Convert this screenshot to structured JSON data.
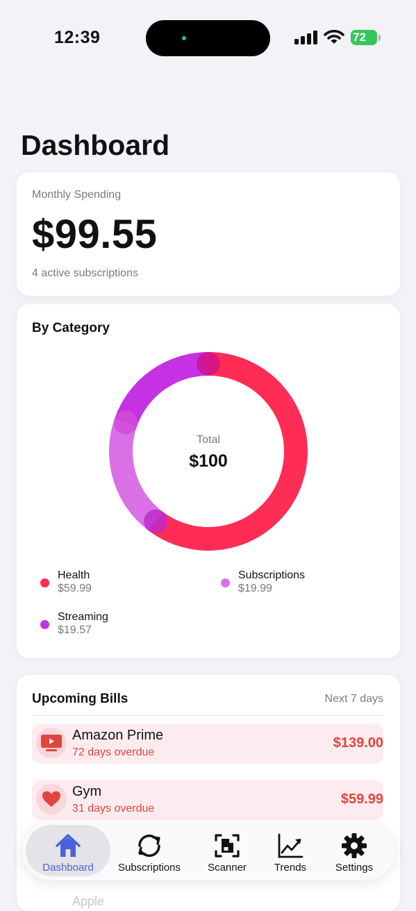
{
  "status_bar": {
    "time": "12:39",
    "battery": "72"
  },
  "page": {
    "title": "Dashboard"
  },
  "monthly": {
    "label": "Monthly Spending",
    "amount": "$99.55",
    "subtitle": "4 active subscriptions"
  },
  "category": {
    "title": "By Category",
    "center_label": "Total",
    "center_value": "$100"
  },
  "chart_data": {
    "type": "pie",
    "title": "By Category",
    "categories": [
      "Health",
      "Subscriptions",
      "Streaming"
    ],
    "values": [
      59.99,
      19.99,
      19.57
    ],
    "value_labels": [
      "$59.99",
      "$19.99",
      "$19.57"
    ],
    "colors": [
      "#ff2d55",
      "#da70e6",
      "#c532e3"
    ],
    "center_label": "Total",
    "center_value": "$100",
    "legend": "bottom"
  },
  "bills": {
    "title": "Upcoming Bills",
    "range": "Next 7 days",
    "items": [
      {
        "name": "Amazon Prime",
        "due": "72 days overdue",
        "amount": "$139.00",
        "icon": "tv-icon"
      },
      {
        "name": "Gym",
        "due": "31 days overdue",
        "amount": "$59.99",
        "icon": "heart-icon"
      }
    ],
    "peek_text": "Apple"
  },
  "tabs": [
    {
      "label": "Dashboard",
      "icon": "house-icon",
      "active": true
    },
    {
      "label": "Subscriptions",
      "icon": "refresh-icon",
      "active": false
    },
    {
      "label": "Scanner",
      "icon": "document-scan-icon",
      "active": false
    },
    {
      "label": "Trends",
      "icon": "trend-chart-icon",
      "active": false
    },
    {
      "label": "Settings",
      "icon": "gear-icon",
      "active": false
    }
  ],
  "colors": {
    "accent": "#4a62d8",
    "danger": "#e0453f",
    "bill_background": "#fdecef",
    "background": "#f2f2f7"
  }
}
